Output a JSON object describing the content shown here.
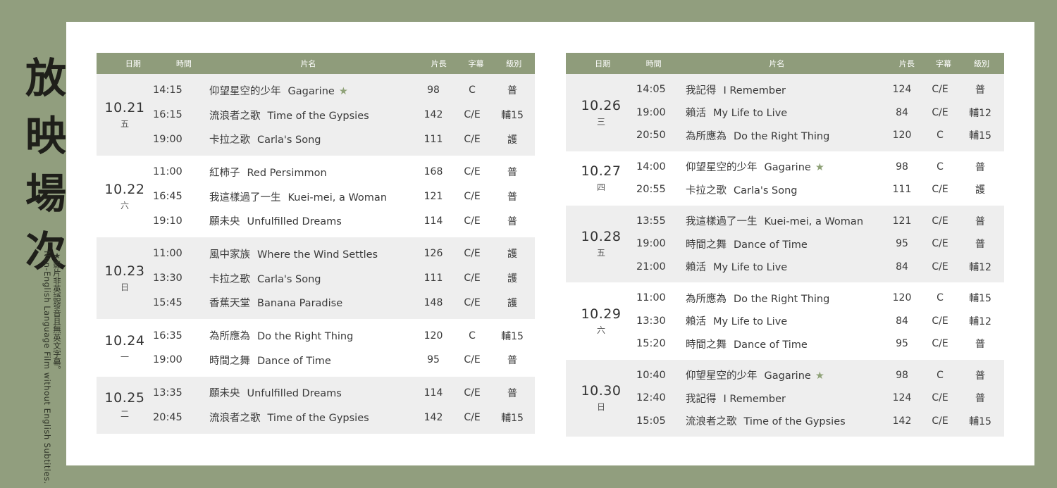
{
  "title": "放映場次",
  "note_zh": "★影片非英語發音且無英文字幕。",
  "note_en": "Non-English Language Film without English Subtitles.",
  "headers": {
    "date": "日期",
    "time": "時間",
    "film": "片名",
    "length": "片長",
    "subtitle": "字幕",
    "rating": "級別"
  },
  "colors": {
    "background": "#919e7e",
    "header": "#8f9c7b",
    "shaded_row": "#eeeeee",
    "star": "#8fa278"
  },
  "left_table": [
    {
      "date": "10.21",
      "weekday": "五",
      "screenings": [
        {
          "time": "14:15",
          "title_zh": "仰望星空的少年",
          "title_en": "Gagarine",
          "star": "★",
          "length": "98",
          "subtitle": "C",
          "rating": "普"
        },
        {
          "time": "16:15",
          "title_zh": "流浪者之歌",
          "title_en": "Time of the Gypsies",
          "star": "",
          "length": "142",
          "subtitle": "C/E",
          "rating": "輔15"
        },
        {
          "time": "19:00",
          "title_zh": "卡拉之歌",
          "title_en": "Carla's Song",
          "star": "",
          "length": "111",
          "subtitle": "C/E",
          "rating": "護"
        }
      ]
    },
    {
      "date": "10.22",
      "weekday": "六",
      "screenings": [
        {
          "time": "11:00",
          "title_zh": "紅柿子",
          "title_en": "Red Persimmon",
          "star": "",
          "length": "168",
          "subtitle": "C/E",
          "rating": "普"
        },
        {
          "time": "16:45",
          "title_zh": "我這樣過了一生",
          "title_en": "Kuei-mei, a Woman",
          "star": "",
          "length": "121",
          "subtitle": "C/E",
          "rating": "普"
        },
        {
          "time": "19:10",
          "title_zh": "願未央",
          "title_en": "Unfulfilled Dreams",
          "star": "",
          "length": "114",
          "subtitle": "C/E",
          "rating": "普"
        }
      ]
    },
    {
      "date": "10.23",
      "weekday": "日",
      "screenings": [
        {
          "time": "11:00",
          "title_zh": "風中家族",
          "title_en": "Where the Wind Settles",
          "star": "",
          "length": "126",
          "subtitle": "C/E",
          "rating": "護"
        },
        {
          "time": "13:30",
          "title_zh": "卡拉之歌",
          "title_en": "Carla's Song",
          "star": "",
          "length": "111",
          "subtitle": "C/E",
          "rating": "護"
        },
        {
          "time": "15:45",
          "title_zh": "香蕉天堂",
          "title_en": "Banana Paradise",
          "star": "",
          "length": "148",
          "subtitle": "C/E",
          "rating": "護"
        }
      ]
    },
    {
      "date": "10.24",
      "weekday": "一",
      "screenings": [
        {
          "time": "16:35",
          "title_zh": "為所應為",
          "title_en": "Do the Right Thing",
          "star": "",
          "length": "120",
          "subtitle": "C",
          "rating": "輔15"
        },
        {
          "time": "19:00",
          "title_zh": "時間之舞",
          "title_en": "Dance of Time",
          "star": "",
          "length": "95",
          "subtitle": "C/E",
          "rating": "普"
        }
      ]
    },
    {
      "date": "10.25",
      "weekday": "二",
      "screenings": [
        {
          "time": "13:35",
          "title_zh": "願未央",
          "title_en": "Unfulfilled Dreams",
          "star": "",
          "length": "114",
          "subtitle": "C/E",
          "rating": "普"
        },
        {
          "time": "20:45",
          "title_zh": "流浪者之歌",
          "title_en": "Time of the Gypsies",
          "star": "",
          "length": "142",
          "subtitle": "C/E",
          "rating": "輔15"
        }
      ]
    }
  ],
  "right_table": [
    {
      "date": "10.26",
      "weekday": "三",
      "screenings": [
        {
          "time": "14:05",
          "title_zh": "我記得",
          "title_en": "I Remember",
          "star": "",
          "length": "124",
          "subtitle": "C/E",
          "rating": "普"
        },
        {
          "time": "19:00",
          "title_zh": "賴活",
          "title_en": "My Life to Live",
          "star": "",
          "length": "84",
          "subtitle": "C/E",
          "rating": "輔12"
        },
        {
          "time": "20:50",
          "title_zh": "為所應為",
          "title_en": "Do the Right Thing",
          "star": "",
          "length": "120",
          "subtitle": "C",
          "rating": "輔15"
        }
      ]
    },
    {
      "date": "10.27",
      "weekday": "四",
      "screenings": [
        {
          "time": "14:00",
          "title_zh": "仰望星空的少年",
          "title_en": "Gagarine",
          "star": "★",
          "length": "98",
          "subtitle": "C",
          "rating": "普"
        },
        {
          "time": "20:55",
          "title_zh": "卡拉之歌",
          "title_en": "Carla's Song",
          "star": "",
          "length": "111",
          "subtitle": "C/E",
          "rating": "護"
        }
      ]
    },
    {
      "date": "10.28",
      "weekday": "五",
      "screenings": [
        {
          "time": "13:55",
          "title_zh": "我這樣過了一生",
          "title_en": "Kuei-mei, a Woman",
          "star": "",
          "length": "121",
          "subtitle": "C/E",
          "rating": "普"
        },
        {
          "time": "19:00",
          "title_zh": "時間之舞",
          "title_en": "Dance of Time",
          "star": "",
          "length": "95",
          "subtitle": "C/E",
          "rating": "普"
        },
        {
          "time": "21:00",
          "title_zh": "賴活",
          "title_en": "My Life to Live",
          "star": "",
          "length": "84",
          "subtitle": "C/E",
          "rating": "輔12"
        }
      ]
    },
    {
      "date": "10.29",
      "weekday": "六",
      "screenings": [
        {
          "time": "11:00",
          "title_zh": "為所應為",
          "title_en": "Do the Right Thing",
          "star": "",
          "length": "120",
          "subtitle": "C",
          "rating": "輔15"
        },
        {
          "time": "13:30",
          "title_zh": "賴活",
          "title_en": "My Life to Live",
          "star": "",
          "length": "84",
          "subtitle": "C/E",
          "rating": "輔12"
        },
        {
          "time": "15:20",
          "title_zh": "時間之舞",
          "title_en": "Dance of Time",
          "star": "",
          "length": "95",
          "subtitle": "C/E",
          "rating": "普"
        }
      ]
    },
    {
      "date": "10.30",
      "weekday": "日",
      "screenings": [
        {
          "time": "10:40",
          "title_zh": "仰望星空的少年",
          "title_en": "Gagarine",
          "star": "★",
          "length": "98",
          "subtitle": "C",
          "rating": "普"
        },
        {
          "time": "12:40",
          "title_zh": "我記得",
          "title_en": "I Remember",
          "star": "",
          "length": "124",
          "subtitle": "C/E",
          "rating": "普"
        },
        {
          "time": "15:05",
          "title_zh": "流浪者之歌",
          "title_en": "Time of the Gypsies",
          "star": "",
          "length": "142",
          "subtitle": "C/E",
          "rating": "輔15"
        }
      ]
    }
  ]
}
